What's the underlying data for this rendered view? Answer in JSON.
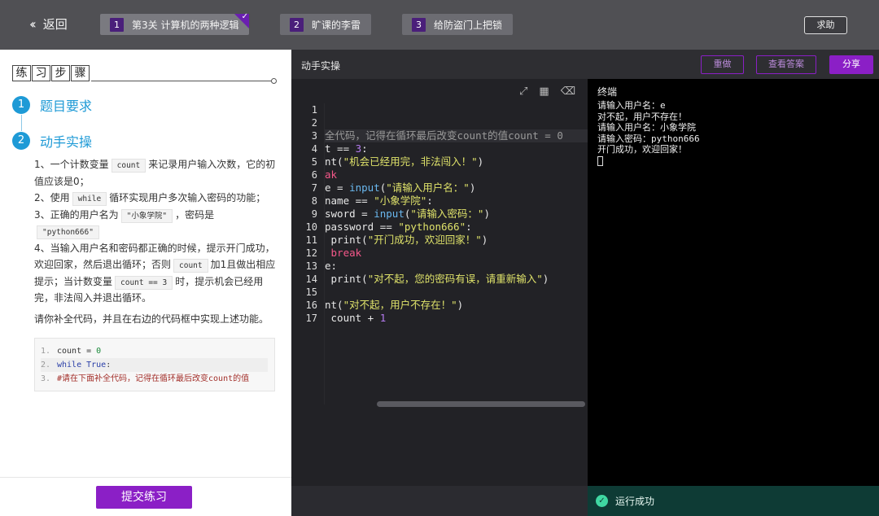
{
  "topbar": {
    "back_label": "返回",
    "steps": [
      {
        "num": "1",
        "label": "第3关 计算机的两种逻辑",
        "completed": true
      },
      {
        "num": "2",
        "label": "旷课的李雷"
      },
      {
        "num": "3",
        "label": "给防盗门上把锁"
      }
    ],
    "help_label": "求助"
  },
  "left": {
    "steps_title": [
      "练",
      "习",
      "步",
      "骤"
    ],
    "step_items": [
      {
        "num": "1",
        "label": "题目要求"
      },
      {
        "num": "2",
        "label": "动手实操"
      }
    ],
    "desc": {
      "p1_a": "1、一个计数变量",
      "p1_chip": "count",
      "p1_b": "来记录用户输入次数，它的初值应该是0；",
      "p2_a": "2、使用",
      "p2_chip": "while",
      "p2_b": "循环实现用户多次输入密码的功能；",
      "p3_a": "3、正确的用户名为",
      "p3_chip": "\"小象学院\"",
      "p3_b": "，密码是",
      "p3_chip2": "\"python666\"",
      "p4_a": "4、当输入用户名和密码都正确的时候，提示开门成功，欢迎回家，然后退出循环；否则",
      "p4_chip": "count",
      "p4_b": "加1且做出相应提示；当计数变量",
      "p4_chip2": "count == 3",
      "p4_c": "时，提示机会已经用完，非法闯入并退出循环。"
    },
    "prompt": "请你补全代码，并且在右边的代码框中实现上述功能。",
    "snippet": [
      {
        "ln": "1.",
        "parts": [
          {
            "t": "count = ",
            "c": ""
          },
          {
            "t": "0",
            "c": "nm"
          }
        ]
      },
      {
        "ln": "2.",
        "parts": [
          {
            "t": "while True",
            "c": "kw"
          },
          {
            "t": ":",
            "c": ""
          }
        ]
      },
      {
        "ln": "3.",
        "parts": [
          {
            "t": "#请在下面补全代码，记得在循环最后改变count的值",
            "c": "cm"
          }
        ]
      }
    ],
    "submit_label": "提交练习"
  },
  "editor": {
    "title": "动手实操",
    "buttons": {
      "reset": "重做",
      "answer": "查看答案",
      "share": "分享"
    },
    "icons": [
      "expand-icon",
      "layout-icon",
      "eraser-icon"
    ],
    "line_numbers": [
      "1",
      "2",
      "3",
      "4",
      "5",
      "6",
      "7",
      "8",
      "9",
      "10",
      "11",
      "12",
      "13",
      "14",
      "15",
      "16",
      "17"
    ],
    "lines": [
      [],
      [],
      [
        {
          "t": "全代码，记得在循环最后改变count的值count = 0",
          "c": "cm"
        }
      ],
      [
        {
          "t": "t == ",
          "c": ""
        },
        {
          "t": "3",
          "c": "num"
        },
        {
          "t": ":",
          "c": ""
        }
      ],
      [
        {
          "t": "nt(",
          "c": ""
        },
        {
          "t": "\"机会已经用完，非法闯入！\"",
          "c": "str"
        },
        {
          "t": ")",
          "c": ""
        }
      ],
      [
        {
          "t": "ak",
          "c": "kw"
        }
      ],
      [
        {
          "t": "e = ",
          "c": ""
        },
        {
          "t": "input",
          "c": "fn"
        },
        {
          "t": "(",
          "c": ""
        },
        {
          "t": "\"请输入用户名：\"",
          "c": "str"
        },
        {
          "t": ")",
          "c": ""
        }
      ],
      [
        {
          "t": "name == ",
          "c": ""
        },
        {
          "t": "\"小象学院\"",
          "c": "str"
        },
        {
          "t": ":",
          "c": ""
        }
      ],
      [
        {
          "t": "sword = ",
          "c": ""
        },
        {
          "t": "input",
          "c": "fn"
        },
        {
          "t": "(",
          "c": ""
        },
        {
          "t": "\"请输入密码：\"",
          "c": "str"
        },
        {
          "t": ")",
          "c": ""
        }
      ],
      [
        {
          "t": "password == ",
          "c": ""
        },
        {
          "t": "\"python666\"",
          "c": "str"
        },
        {
          "t": ":",
          "c": ""
        }
      ],
      [
        {
          "t": " print(",
          "c": ""
        },
        {
          "t": "\"开门成功，欢迎回家！\"",
          "c": "str"
        },
        {
          "t": ")",
          "c": ""
        }
      ],
      [
        {
          "t": " break",
          "c": "kw"
        }
      ],
      [
        {
          "t": "e:",
          "c": ""
        }
      ],
      [
        {
          "t": " print(",
          "c": ""
        },
        {
          "t": "\"对不起，您的密码有误，请重新输入\"",
          "c": "str"
        },
        {
          "t": ")",
          "c": ""
        }
      ],
      [],
      [
        {
          "t": "nt(",
          "c": ""
        },
        {
          "t": "\"对不起，用户不存在！\"",
          "c": "str"
        },
        {
          "t": ")",
          "c": ""
        }
      ],
      [
        {
          "t": " count + ",
          "c": ""
        },
        {
          "t": "1",
          "c": "num"
        }
      ]
    ]
  },
  "terminal": {
    "title": "终端",
    "lines": [
      "请输入用户名：e",
      "对不起，用户不存在！",
      "请输入用户名：小象学院",
      "请输入密码：python666",
      "开门成功，欢迎回家！"
    ]
  },
  "status": {
    "text": "运行成功"
  },
  "colors": {
    "accent": "#8b1fc6",
    "step_blue": "#1e9ad6",
    "success": "#3fd8a2"
  }
}
